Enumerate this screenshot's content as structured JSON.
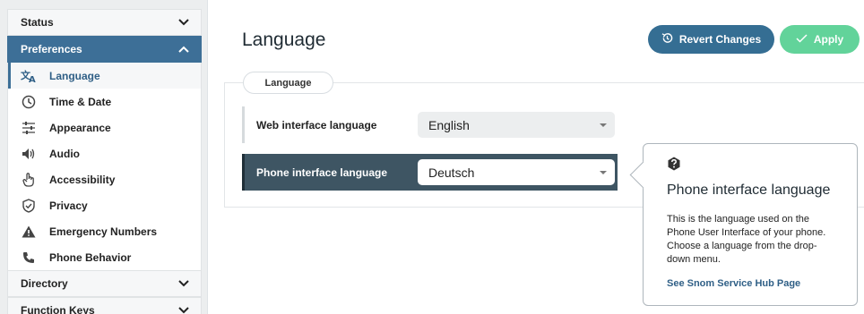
{
  "sidebar": {
    "sections": {
      "status": "Status",
      "preferences": "Preferences",
      "directory": "Directory",
      "function_keys": "Function Keys"
    },
    "items": [
      {
        "label": "Language",
        "icon": "translate-icon"
      },
      {
        "label": "Time & Date",
        "icon": "clock-icon"
      },
      {
        "label": "Appearance",
        "icon": "sliders-icon"
      },
      {
        "label": "Audio",
        "icon": "speaker-icon"
      },
      {
        "label": "Accessibility",
        "icon": "hand-icon"
      },
      {
        "label": "Privacy",
        "icon": "shield-check-icon"
      },
      {
        "label": "Emergency Numbers",
        "icon": "warning-icon"
      },
      {
        "label": "Phone Behavior",
        "icon": "phone-icon"
      }
    ]
  },
  "main": {
    "title": "Language",
    "revert_label": "Revert Changes",
    "apply_label": "Apply",
    "tab_label": "Language",
    "web_label": "Web interface language",
    "web_value": "English",
    "phone_label": "Phone interface language",
    "phone_value": "Deutsch"
  },
  "tooltip": {
    "title": "Phone interface language",
    "body": "This is the language used on the Phone User Interface of your phone. Choose a language from the drop-down menu.",
    "link": "See Snom Service Hub Page"
  },
  "colors": {
    "accent": "#3d6f97",
    "apply": "#62d39a",
    "revert": "#356e93",
    "selected_row": "#3e5563"
  }
}
